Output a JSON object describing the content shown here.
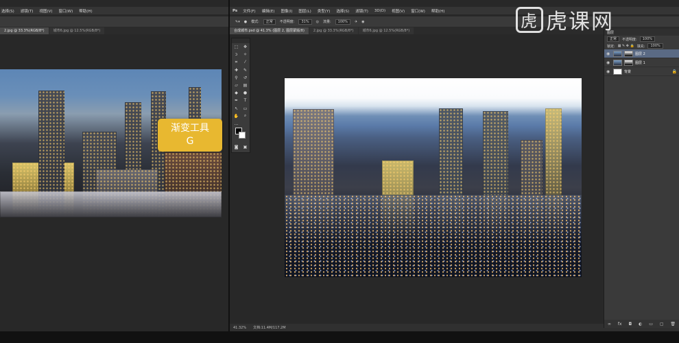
{
  "left_window": {
    "menu": [
      "选择(S)",
      "滤镜(T)",
      "视图(V)",
      "窗口(W)",
      "帮助(H)"
    ],
    "tabs": [
      "2.jpg @ 33.3%(RGB/8*)",
      "城市6.jpg @ 12.5%(RGB/8*)"
    ]
  },
  "right_window": {
    "app_logo": "Ps",
    "menu": [
      "文件(F)",
      "编辑(E)",
      "图像(I)",
      "图层(L)",
      "类型(Y)",
      "选择(S)",
      "滤镜(T)",
      "3D(D)",
      "视图(V)",
      "窗口(W)",
      "帮助(H)"
    ],
    "options": {
      "mode_label": "模式:",
      "mode_value": "正常",
      "opacity_label": "不透明度:",
      "opacity_value": "31%",
      "flow_label": "流量:",
      "flow_value": "100%"
    },
    "tabs": [
      "合成城市.psd @ 41.3% (图层 2, 图层蒙版/8)",
      "2.jpg @ 33.3%(RGB/8*)",
      "城市6.jpg @ 12.5%(RGB/8*)"
    ],
    "status": {
      "zoom": "41.32%",
      "doc": "文档:11.4M/117.2M"
    }
  },
  "tooltip": {
    "line1": "渐变工具",
    "line2": "G",
    "color": "#e8b830"
  },
  "layers_panel": {
    "tab": "图层",
    "blend_mode": "正常",
    "opacity_label": "不透明度:",
    "opacity_value": "100%",
    "lock_label": "锁定:",
    "fill_label": "填充:",
    "fill_value": "100%",
    "layers": [
      {
        "name": "图层 2",
        "selected": true
      },
      {
        "name": "图层 1",
        "selected": false
      },
      {
        "name": "背景",
        "selected": false
      }
    ]
  },
  "watermark": {
    "text": "虎课网"
  }
}
